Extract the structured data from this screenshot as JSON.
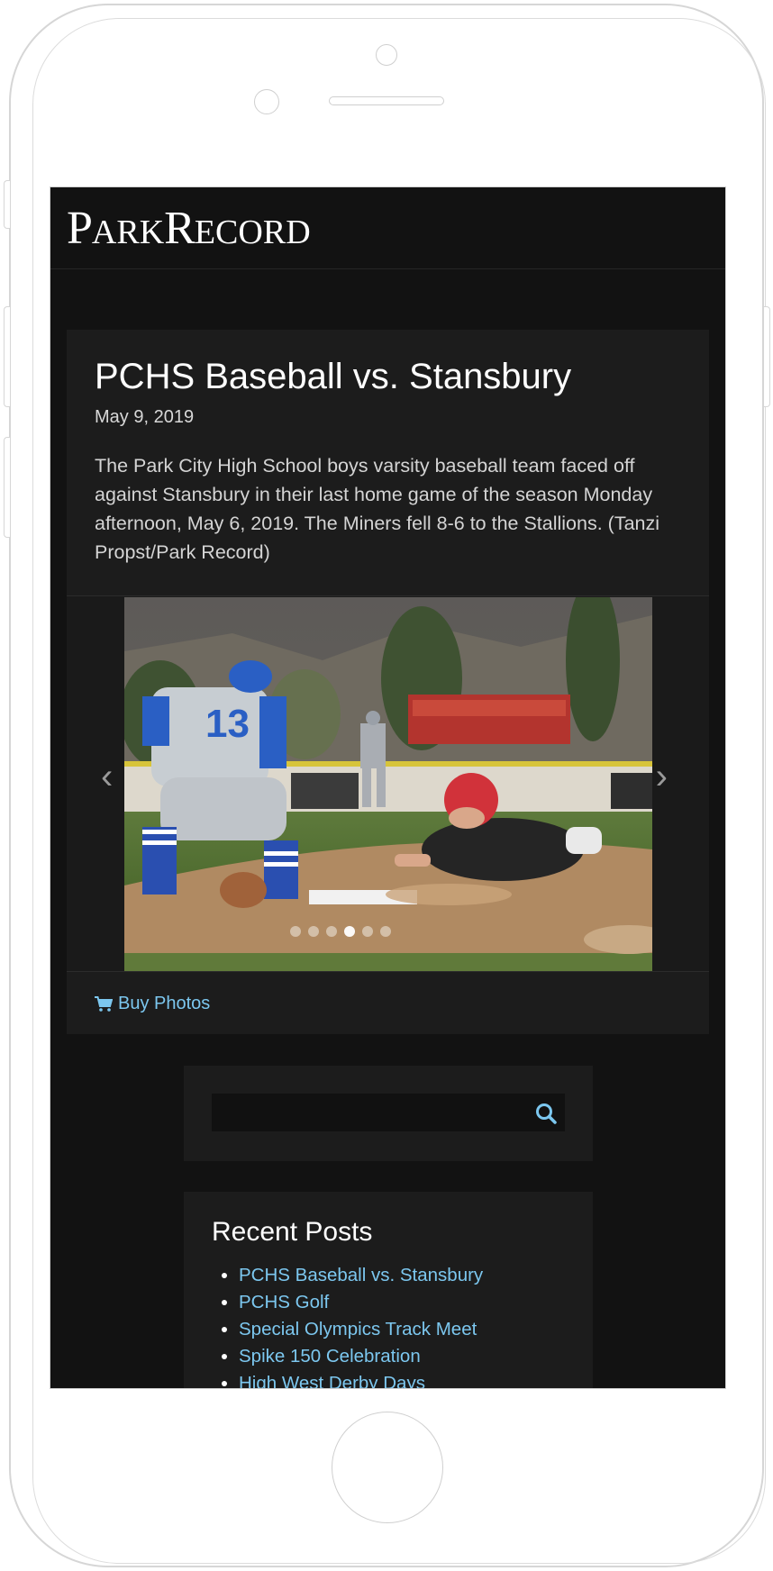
{
  "site": {
    "logo_text_p": "P",
    "logo_text_ark": "ARK",
    "logo_text_r": "R",
    "logo_text_ecord": "ECORD"
  },
  "post": {
    "title": "PCHS Baseball vs. Stansbury",
    "date": "May 9, 2019",
    "description": "The Park City High School boys varsity baseball team faced off against Stansbury in their last home game of the season Monday afternoon, May 6, 2019. The Miners fell 8-6 to the Stallions. (Tanzi Propst/Park Record)",
    "prev_arrow": "‹",
    "next_arrow": "›",
    "slide_count": 6,
    "active_slide": 4,
    "player_number": "13",
    "buy_label": "Buy Photos"
  },
  "search": {
    "placeholder": ""
  },
  "recent_posts": {
    "title": "Recent Posts",
    "items": [
      "PCHS Baseball vs. Stansbury",
      "PCHS Golf",
      "Special Olympics Track Meet",
      "Spike 150 Celebration",
      "High West Derby Days"
    ]
  },
  "colors": {
    "background": "#121212",
    "card": "#1c1c1c",
    "link": "#7cc7ef"
  },
  "icons": {
    "cart": "shopping-cart-icon",
    "search": "search-icon"
  }
}
